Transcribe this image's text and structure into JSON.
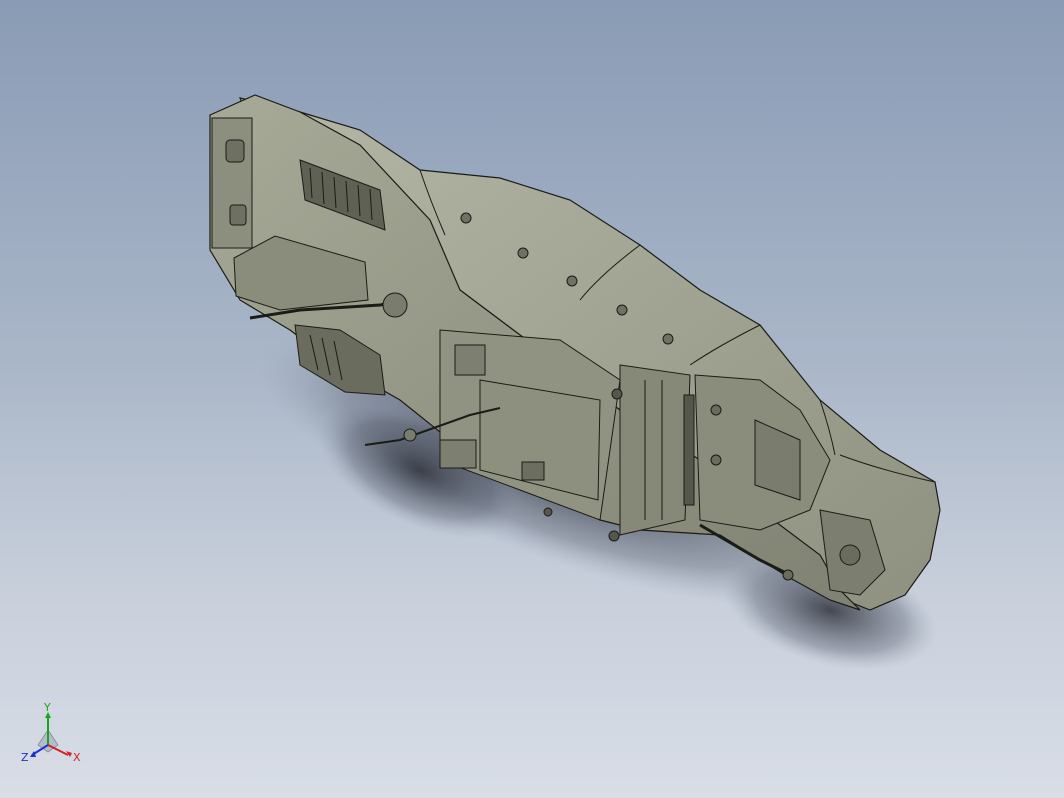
{
  "triad": {
    "x_label": "X",
    "y_label": "Y",
    "z_label": "Z",
    "x_color": "#d62020",
    "y_color": "#1aa51a",
    "z_color": "#2030d0"
  },
  "colors": {
    "background_top": "#8a9bb5",
    "background_bottom": "#d8dde6",
    "model_body": "#9ea08e",
    "model_edges": "#1a1c16",
    "shadow": "#2c3038"
  }
}
